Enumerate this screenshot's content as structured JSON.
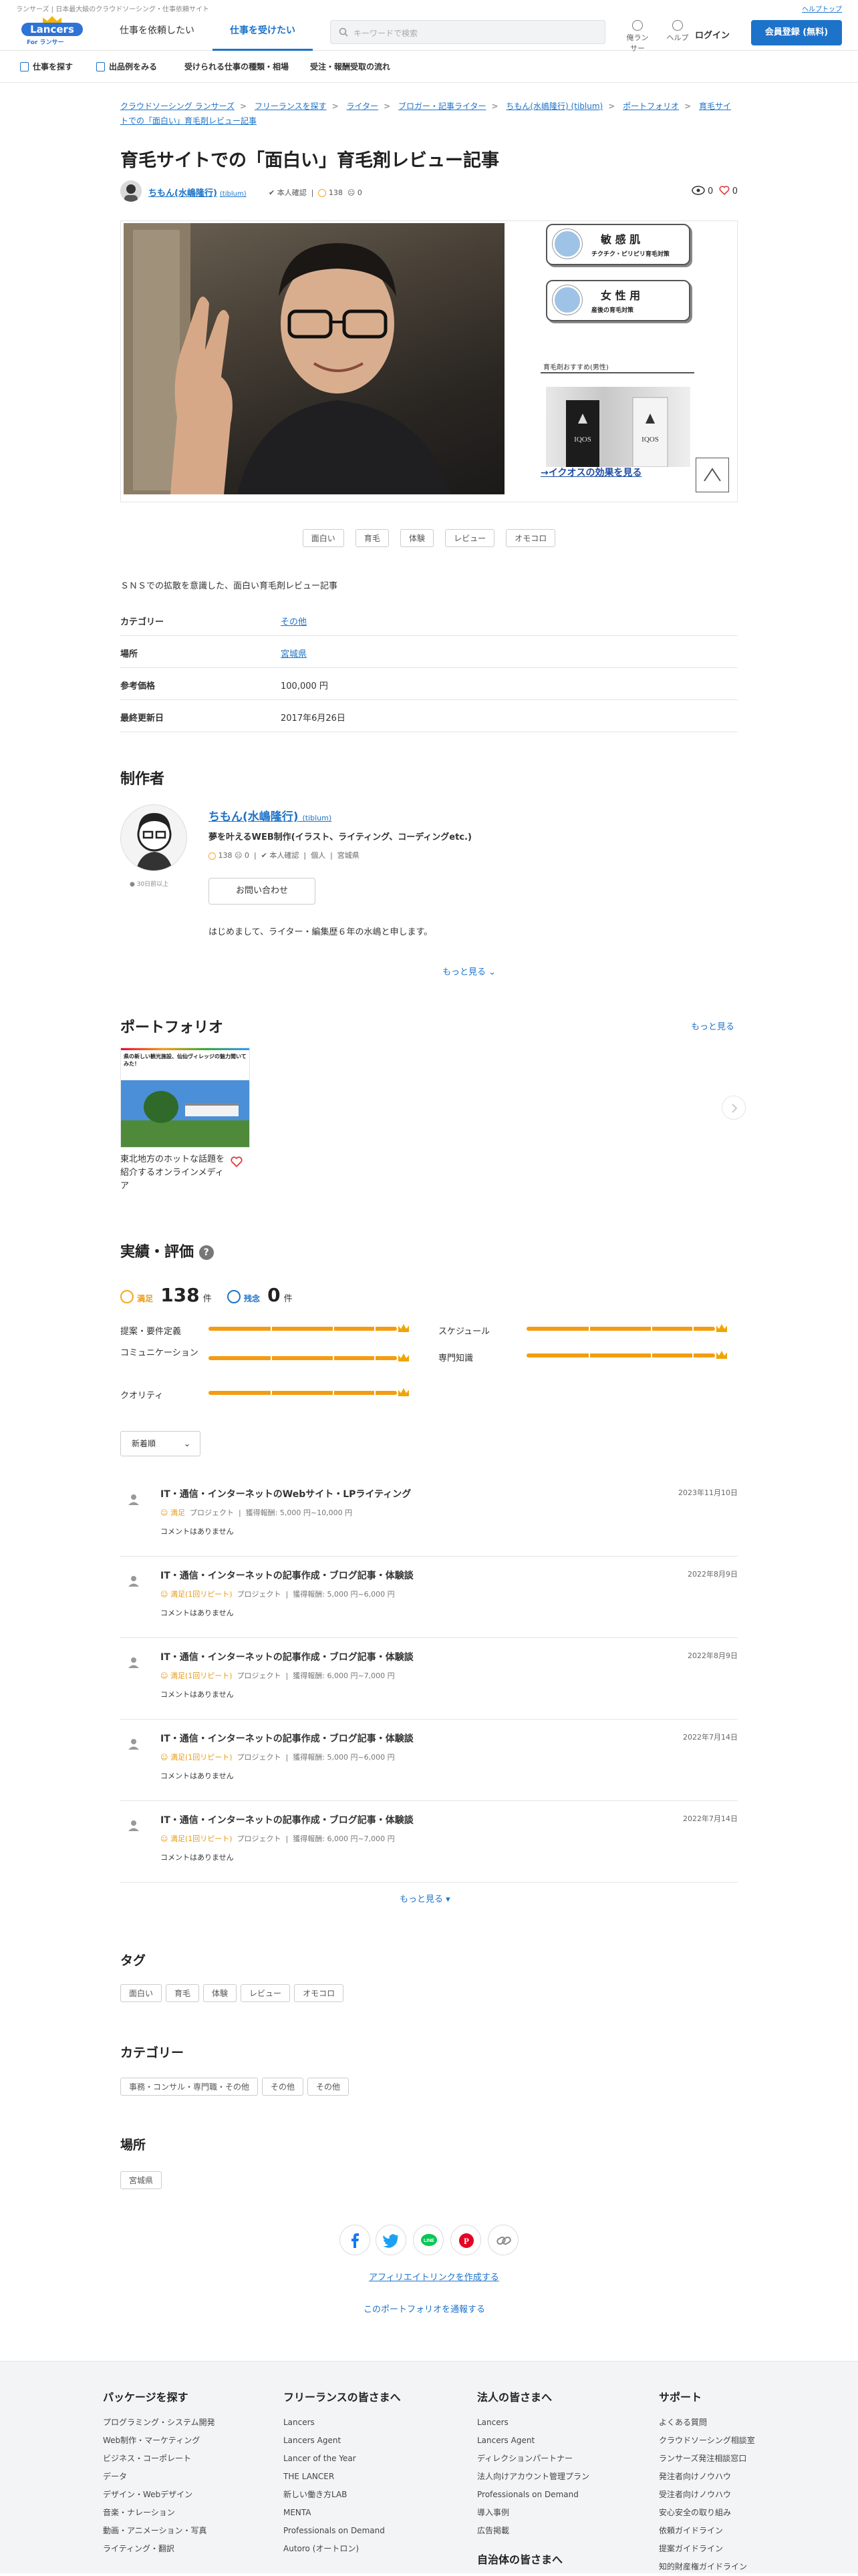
{
  "topbar": {
    "tagline": "ランサーズ | 日本最大級のクラウドソーシング・仕事依頼サイト",
    "help": "ヘルプトップ"
  },
  "header": {
    "logo": "Lancers",
    "logo_sub": "For ランサー",
    "tabs": [
      "仕事を依頼したい",
      "仕事を受けたい"
    ],
    "search_placeholder": "キーワードで検索",
    "icons": [
      {
        "label": "俺ランサー",
        "icon": "user-icon"
      },
      {
        "label": "ヘルプ",
        "icon": "help-icon"
      }
    ],
    "login": "ログイン",
    "register": "会員登録 (無料)"
  },
  "subnav": [
    "仕事を探す",
    "出品例をみる",
    "受けられる仕事の種類・相場",
    "受注・報酬受取の流れ"
  ],
  "breadcrumb": [
    "クラウドソーシング ランサーズ",
    "フリーランスを探す",
    "ライター",
    "ブロガー・記事ライター",
    "ちもん(水嶋隆行) (tiblum)",
    "ポートフォリオ",
    "育毛サイトでの「面白い」育毛剤レビュー記事"
  ],
  "title": "育毛サイトでの「面白い」育毛剤レビュー記事",
  "author": {
    "name": "ちもん(水嶋隆行)",
    "id": "(tiblum)",
    "verified": "本人確認",
    "good": "138",
    "bad": "0"
  },
  "counts": {
    "views": "0",
    "likes": "0"
  },
  "ad": {
    "btn1_title": "敏 感 肌",
    "btn1_sub": "チクチク・ピリピリ育毛対策",
    "btn2_title": "女 性 用",
    "btn2_sub": "産後の育毛対策",
    "note": "育毛剤おすすめ(男性)",
    "product": "IQOS",
    "link": "→イクオスの効果を見る"
  },
  "tags": [
    "面白い",
    "育毛",
    "体験",
    "レビュー",
    "オモコロ"
  ],
  "description": "ＳＮＳでの拡散を意識した、面白い育毛剤レビュー記事",
  "specs": [
    {
      "k": "カテゴリー",
      "v": "その他",
      "link": true
    },
    {
      "k": "場所",
      "v": "宮城県",
      "link": true
    },
    {
      "k": "参考価格",
      "v": "100,000 円",
      "link": false
    },
    {
      "k": "最終更新日",
      "v": "2017年6月26日",
      "link": false
    }
  ],
  "maker": {
    "heading": "制作者",
    "name": "ちもん(水嶋隆行)",
    "id": "(tiblum)",
    "online": "30日前以上",
    "tagline": "夢を叶えるWEB制作(イラスト、ライティング、コーディングetc.)",
    "good": "138",
    "bad": "0",
    "verified": "本人確認",
    "type": "個人",
    "place": "宮城県",
    "contact": "お問い合わせ",
    "intro": "はじめまして、ライター・編集歴６年の水嶋と申します。",
    "more": "もっと見る"
  },
  "portfolio": {
    "heading": "ポートフォリオ",
    "more": "もっと見る",
    "card_img_text": "県の新しい観光施設、仙仙ヴィレッジの魅力聞いてみた！",
    "card_title": "東北地方のホットな話題を紹介するオンラインメディア"
  },
  "results": {
    "heading": "実績・評価",
    "satisfied_label": "満足",
    "satisfied": "138",
    "unit": "件",
    "regret_label": "残念",
    "regret": "0",
    "ratings": [
      {
        "label": "提案・要件定義",
        "value": 1.0
      },
      {
        "label": "コミュニケーション",
        "value": 1.0
      },
      {
        "label": "クオリティ",
        "value": 1.0
      },
      {
        "label": "スケジュール",
        "value": 1.0
      },
      {
        "label": "専門知識",
        "value": 1.0
      }
    ],
    "sort": "新着順"
  },
  "reviews": [
    {
      "title": "IT・通信・インターネットのWebサイト・LPライティング",
      "sat": "満足",
      "repeat": "",
      "kind": "プロジェクト",
      "fee": "獲得報酬: 5,000 円~10,000 円",
      "date": "2023年11月10日",
      "comment": "コメントはありません"
    },
    {
      "title": "IT・通信・インターネットの記事作成・ブログ記事・体験談",
      "sat": "満足",
      "repeat": "(1回リピート)",
      "kind": "プロジェクト",
      "fee": "獲得報酬: 5,000 円~6,000 円",
      "date": "2022年8月9日",
      "comment": "コメントはありません"
    },
    {
      "title": "IT・通信・インターネットの記事作成・ブログ記事・体験談",
      "sat": "満足",
      "repeat": "(1回リピート)",
      "kind": "プロジェクト",
      "fee": "獲得報酬: 6,000 円~7,000 円",
      "date": "2022年8月9日",
      "comment": "コメントはありません"
    },
    {
      "title": "IT・通信・インターネットの記事作成・ブログ記事・体験談",
      "sat": "満足",
      "repeat": "(1回リピート)",
      "kind": "プロジェクト",
      "fee": "獲得報酬: 5,000 円~6,000 円",
      "date": "2022年7月14日",
      "comment": "コメントはありません"
    },
    {
      "title": "IT・通信・インターネットの記事作成・ブログ記事・体験談",
      "sat": "満足",
      "repeat": "(1回リピート)",
      "kind": "プロジェクト",
      "fee": "獲得報酬: 6,000 円~7,000 円",
      "date": "2022年7月14日",
      "comment": "コメントはありません"
    }
  ],
  "reviews_more": "もっと見る",
  "tag_section": {
    "heading": "タグ",
    "items": [
      "面白い",
      "育毛",
      "体験",
      "レビュー",
      "オモコロ"
    ]
  },
  "category_section": {
    "heading": "カテゴリー",
    "items": [
      "事務・コンサル・専門職・その他",
      "その他",
      "その他"
    ]
  },
  "place_section": {
    "heading": "場所",
    "items": [
      "宮城県"
    ]
  },
  "share": {
    "icons": [
      "facebook-icon",
      "twitter-icon",
      "line-icon",
      "pinterest-icon",
      "link-icon"
    ],
    "affiliate": "アフィリエイトリンクを作成する",
    "report": "このポートフォリオを通報する"
  },
  "footer": [
    {
      "h": "パッケージを探す",
      "items": [
        "プログラミング・システム開発",
        "Web制作・マーケティング",
        "ビジネス・コーポレート",
        "データ",
        "デザイン・Webデザイン",
        "音楽・ナレーション",
        "動画・アニメーション・写真",
        "ライティング・翻訳"
      ]
    },
    {
      "h": "フリーランスの皆さまへ",
      "items": [
        "Lancers",
        "Lancers Agent",
        "Lancer of the Year",
        "THE LANCER",
        "新しい働き方LAB",
        "MENTA",
        "Professionals on Demand",
        "Autoro (オートロン)"
      ]
    },
    {
      "h": "法人の皆さまへ",
      "items": [
        "Lancers",
        "Lancers Agent",
        "ディレクションパートナー",
        "法人向けアカウント管理プラン",
        "Professionals on Demand",
        "導入事例",
        "広告掲載"
      ],
      "h2": "自治体の皆さまへ"
    },
    {
      "h": "サポート",
      "items": [
        "よくある質問",
        "クラウドソーシング相談室",
        "ランサーズ発注相談窓口",
        "発注者向けノウハウ",
        "受注者向けノウハウ",
        "安心安全の取り組み",
        "依頼ガイドライン",
        "提案ガイドライン",
        "知的財産権ガイドライン"
      ]
    }
  ],
  "colors": {
    "accent": "#1d73c9",
    "satisfied": "#f39c12",
    "link": "#1d4fa6"
  }
}
